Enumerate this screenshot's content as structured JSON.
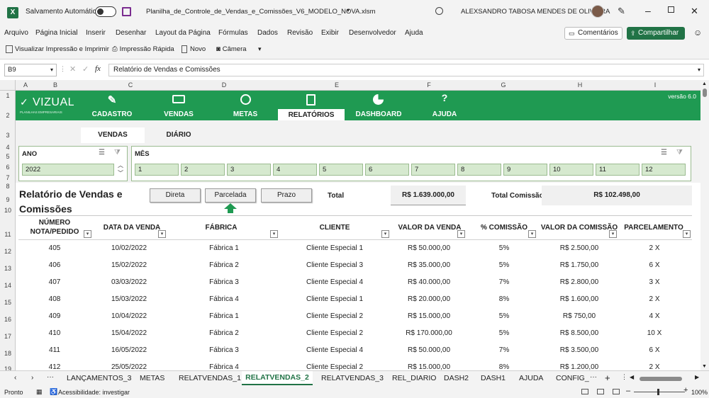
{
  "titlebar": {
    "autosave_label": "Salvamento Automático",
    "filename": "Planilha_de_Controle_de_Vendas_e_Comissões_V6_MODELO_NOVA.xlsm",
    "user": "ALEXSANDRO TABOSA MENDES DE OLIVEIRA"
  },
  "menu": {
    "items": [
      "Arquivo",
      "Página Inicial",
      "Inserir",
      "Desenhar",
      "Layout da Página",
      "Fórmulas",
      "Dados",
      "Revisão",
      "Exibir",
      "Desenvolvedor",
      "Ajuda"
    ],
    "comments": "Comentários",
    "share": "Compartilhar"
  },
  "qat": {
    "print_preview": "Visualizar Impressão e Imprimir",
    "quick_print": "Impressão Rápida",
    "new": "Novo",
    "camera": "Câmera"
  },
  "formula": {
    "cell_ref": "B9",
    "content": "Relatório de Vendas e Comissões"
  },
  "columns": [
    "A",
    "B",
    "C",
    "D",
    "E",
    "F",
    "G",
    "H",
    "I"
  ],
  "rows": [
    "1",
    "2",
    "3",
    "4",
    "5",
    "6",
    "7",
    "8",
    "9",
    "10",
    "11",
    "12",
    "13",
    "14",
    "15",
    "16",
    "17",
    "18",
    "19"
  ],
  "sheet": {
    "logo": "VIZUAL",
    "logo_sub": "PLANILHAS EMPRESARIAIS",
    "version": "versão 6.0",
    "nav": [
      "CADASTRO",
      "VENDAS",
      "METAS",
      "RELATÓRIOS",
      "DASHBOARD",
      "AJUDA"
    ],
    "subtabs": {
      "vendas": "VENDAS",
      "diario": "DIÁRIO"
    },
    "ano_label": "ANO",
    "ano_value": "2022",
    "mes_label": "MÊS",
    "months": [
      "1",
      "2",
      "3",
      "4",
      "5",
      "6",
      "7",
      "8",
      "9",
      "10",
      "11",
      "12"
    ],
    "report_title_1": "Relatório de Vendas e",
    "report_title_2": "Comissões",
    "btn_direta": "Direta",
    "btn_parcelada": "Parcelada",
    "btn_prazo": "Prazo",
    "total_label": "Total",
    "total_value": "R$ 1.639.000,00",
    "total_comissao_label": "Total Comissão",
    "total_comissao_value": "R$ 102.498,00",
    "headers": {
      "numero_1": "NÚMERO",
      "numero_2": "NOTA/PEDIDO",
      "data": "DATA DA VENDA",
      "fabrica": "FÁBRICA",
      "cliente": "CLIENTE",
      "valor": "VALOR DA VENDA",
      "pct": "% COMISSÃO",
      "valor_com": "VALOR DA COMISSÃO",
      "parcelamento": "PARCELAMENTO"
    },
    "table": [
      [
        "405",
        "10/02/2022",
        "Fábrica 1",
        "Cliente Especial 1",
        "R$ 50.000,00",
        "5%",
        "R$ 2.500,00",
        "2 X"
      ],
      [
        "406",
        "15/02/2022",
        "Fábrica 2",
        "Cliente Especial 3",
        "R$ 35.000,00",
        "5%",
        "R$ 1.750,00",
        "6 X"
      ],
      [
        "407",
        "03/03/2022",
        "Fábrica 3",
        "Cliente Especial 4",
        "R$ 40.000,00",
        "7%",
        "R$ 2.800,00",
        "3 X"
      ],
      [
        "408",
        "15/03/2022",
        "Fábrica 4",
        "Cliente Especial 1",
        "R$ 20.000,00",
        "8%",
        "R$ 1.600,00",
        "2 X"
      ],
      [
        "409",
        "10/04/2022",
        "Fábrica 1",
        "Cliente Especial 2",
        "R$ 15.000,00",
        "5%",
        "R$ 750,00",
        "4 X"
      ],
      [
        "410",
        "15/04/2022",
        "Fábrica 2",
        "Cliente Especial 2",
        "R$ 170.000,00",
        "5%",
        "R$ 8.500,00",
        "10 X"
      ],
      [
        "411",
        "16/05/2022",
        "Fábrica 3",
        "Cliente Especial 4",
        "R$ 50.000,00",
        "7%",
        "R$ 3.500,00",
        "6 X"
      ],
      [
        "412",
        "25/05/2022",
        "Fábrica 4",
        "Cliente Especial 2",
        "R$ 15.000,00",
        "8%",
        "R$ 1.200,00",
        "2 X"
      ]
    ]
  },
  "tabs": [
    "LANÇAMENTOS_3",
    "METAS",
    "RELATVENDAS_1",
    "RELATVENDAS_2",
    "RELATVENDAS_3",
    "REL_DIARIO",
    "DASH2",
    "DASH1",
    "AJUDA",
    "CONFIG_"
  ],
  "active_tab": "RELATVENDAS_2",
  "status": {
    "ready": "Pronto",
    "accessibility": "Acessibilidade: investigar",
    "zoom": "100%"
  },
  "colors": {
    "green": "#1f9a52",
    "excel_green": "#217346",
    "chip": "#d6e9cf"
  }
}
